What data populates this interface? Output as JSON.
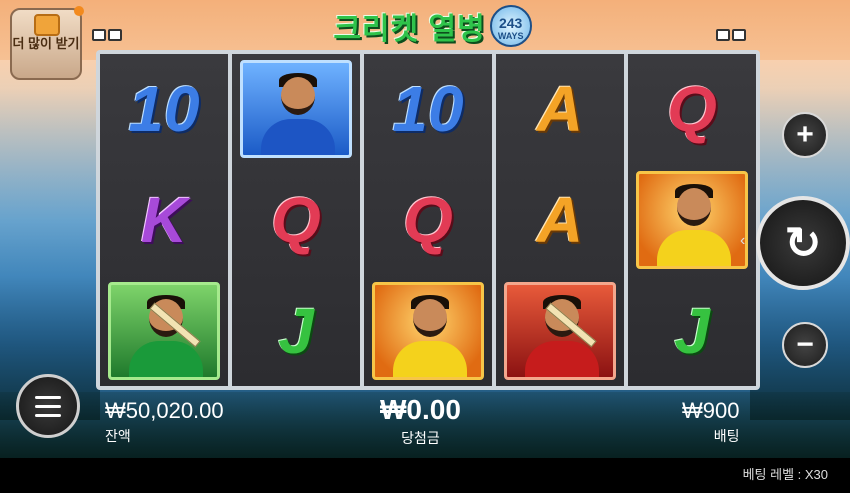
{
  "header": {
    "bonus_button_label": "더 많이 받기",
    "logo_title": "크리켓 열병",
    "logo_ways_number": "243",
    "logo_ways_label": "WAYS"
  },
  "reels": [
    {
      "symbols": [
        {
          "type": "letter",
          "text": "10",
          "kind": "sym-10"
        },
        {
          "type": "letter",
          "text": "K",
          "kind": "sym-K"
        },
        {
          "type": "tile",
          "tile": "green",
          "name": "batsman-green"
        }
      ]
    },
    {
      "symbols": [
        {
          "type": "tile",
          "tile": "blue",
          "name": "player-blue"
        },
        {
          "type": "letter",
          "text": "Q",
          "kind": "sym-Q"
        },
        {
          "type": "letter",
          "text": "J",
          "kind": "sym-J"
        }
      ]
    },
    {
      "symbols": [
        {
          "type": "letter",
          "text": "10",
          "kind": "sym-10"
        },
        {
          "type": "letter",
          "text": "Q",
          "kind": "sym-Q"
        },
        {
          "type": "tile",
          "tile": "gold",
          "name": "player-yellow"
        }
      ]
    },
    {
      "symbols": [
        {
          "type": "letter",
          "text": "A",
          "kind": "sym-A"
        },
        {
          "type": "letter",
          "text": "A",
          "kind": "sym-A"
        },
        {
          "type": "tile",
          "tile": "red",
          "name": "player-red"
        }
      ]
    },
    {
      "symbols": [
        {
          "type": "letter",
          "text": "Q",
          "kind": "sym-Q"
        },
        {
          "type": "tile",
          "tile": "gold",
          "name": "player-yellow"
        },
        {
          "type": "letter",
          "text": "J",
          "kind": "sym-J"
        }
      ]
    }
  ],
  "controls": {
    "plus_label": "+",
    "minus_label": "−",
    "spin_label": "↻",
    "spin_arrow": "‹"
  },
  "stats": {
    "balance_value": "₩50,020.00",
    "balance_label": "잔액",
    "win_value": "₩0.00",
    "win_label": "당첨금",
    "bet_value": "₩900",
    "bet_label": "배팅"
  },
  "footer": {
    "bet_level_text": "베팅 레벨 : X30"
  }
}
